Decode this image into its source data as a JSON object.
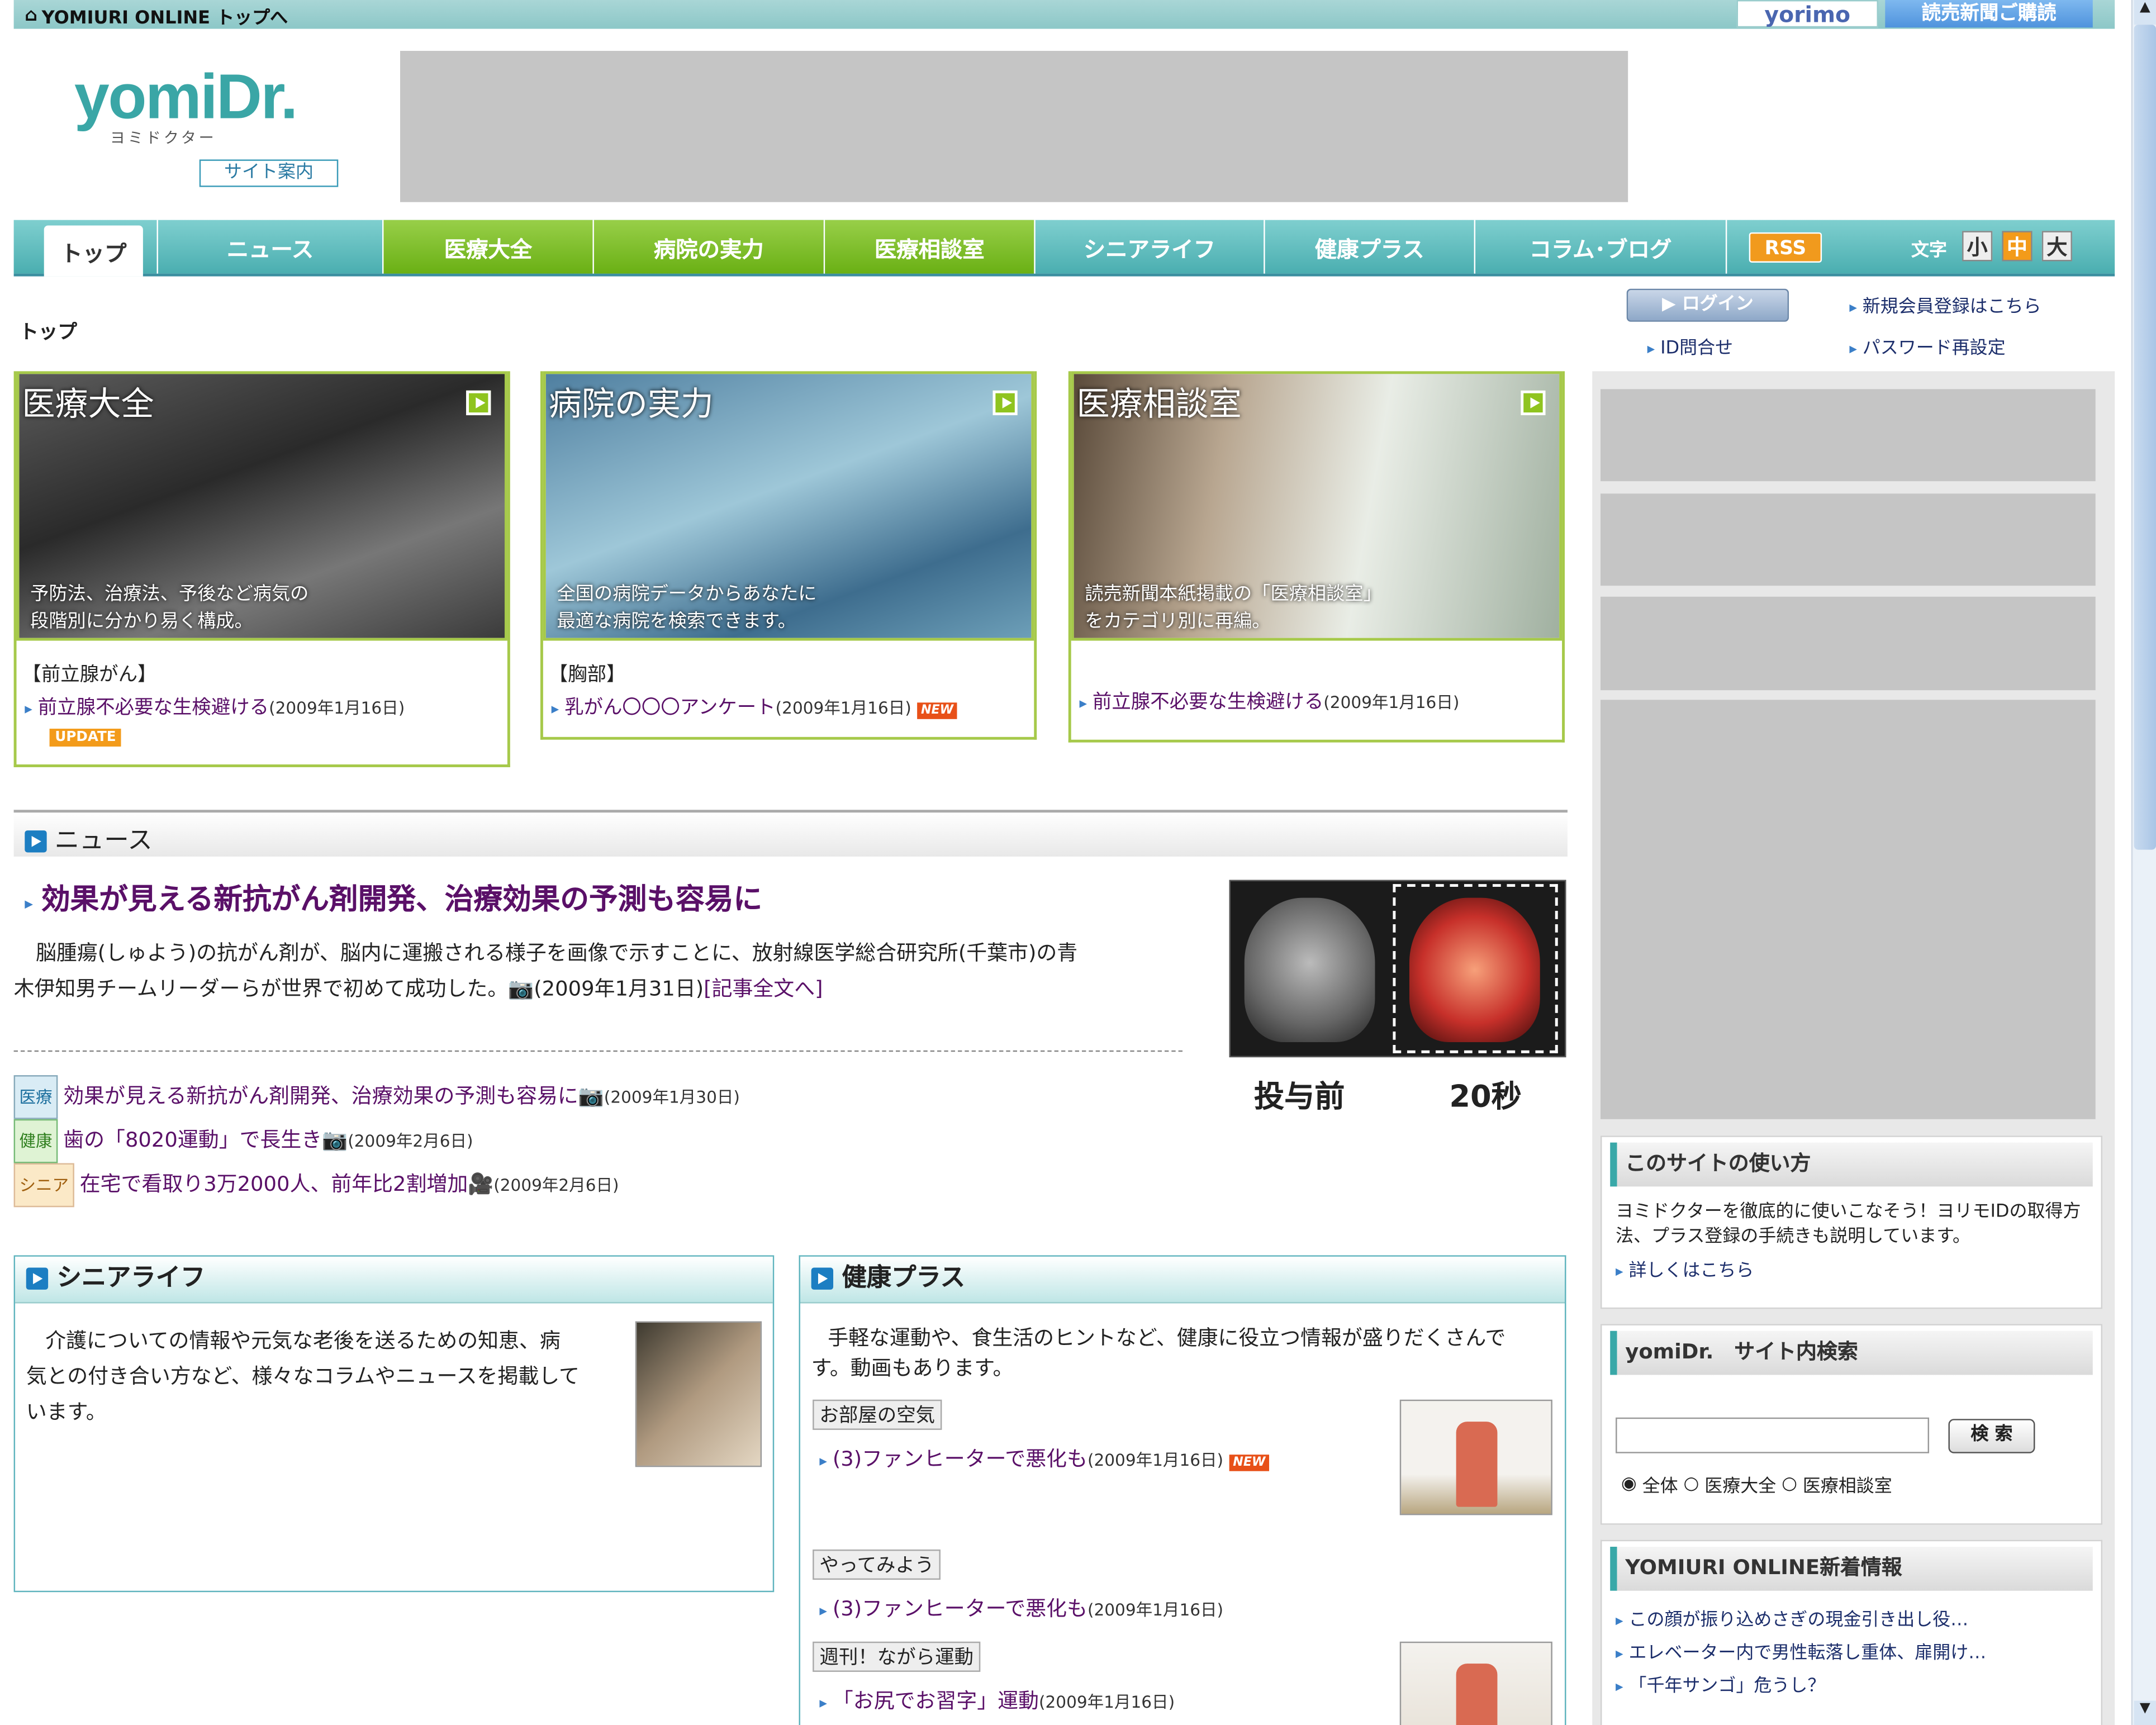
{
  "topbar": {
    "home_label": "YOMIURI ONLINE トップへ",
    "yorimo": "yorimo",
    "subscribe": "読売新聞ご購読"
  },
  "header": {
    "logo": "yomiDr.",
    "logo_sub": "ヨミドクター",
    "site_guide": "サイト案内"
  },
  "nav": {
    "items": [
      "トップ",
      "ニュース",
      "医療大全",
      "病院の実力",
      "医療相談室",
      "シニアライフ",
      "健康プラス",
      "コラム･ブログ"
    ],
    "rss": "RSS",
    "font_label": "文字",
    "sizes": [
      "小",
      "中",
      "大"
    ]
  },
  "breadcrumb": "トップ",
  "account": {
    "login": "▶ ログイン",
    "register": "新規会員登録はこちら",
    "id_inquiry": "ID問合せ",
    "password_reset": "パスワード再設定"
  },
  "features": [
    {
      "title": "医療大全",
      "desc1": "予防法、治療法、予後など病気の",
      "desc2": "段階別に分かり易く構成。",
      "category": "【前立腺がん】",
      "article": "前立腺不必要な生検避ける",
      "date": "(2009年1月16日)",
      "badge": "UPDATE"
    },
    {
      "title": "病院の実力",
      "desc1": "全国の病院データからあなたに",
      "desc2": "最適な病院を検索できます。",
      "category": "【胸部】",
      "article": "乳がん〇〇〇アンケート",
      "date": "(2009年1月16日)",
      "badge": "NEW"
    },
    {
      "title": "医療相談室",
      "desc1": "読売新聞本紙掲載の「医療相談室」",
      "desc2": "をカテゴリ別に再編。",
      "category": "",
      "article": "前立腺不必要な生検避ける",
      "date": "(2009年1月16日)",
      "badge": ""
    }
  ],
  "news": {
    "heading": "ニュース",
    "headline": "効果が見える新抗がん剤開発、治療効果の予測も容易に",
    "body1": "脳腫瘍(しゅよう)の抗がん剤が、脳内に運搬される様子を画像で示すことに、放射線医学総合研究所(千葉市)の青",
    "body2": "木伊知男チームリーダーらが世界で初めて成功した。",
    "date": "(2009年1月31日)",
    "more": "[記事全文へ]",
    "image_caption_left": "投与前",
    "image_caption_right": "20秒",
    "items": [
      {
        "tag": "医療",
        "title": "効果が見える新抗がん剤開発、治療効果の予測も容易に",
        "date": "(2009年1月30日)"
      },
      {
        "tag": "健康",
        "title": "歯の「8020運動」で長生き",
        "date": "(2009年2月6日)"
      },
      {
        "tag": "シニア",
        "title": "在宅で看取り3万2000人、前年比2割増加",
        "date": "(2009年2月6日)"
      }
    ]
  },
  "senior": {
    "heading": "シニアライフ",
    "desc1": "介護についての情報や元気な老後を送るための知恵、病",
    "desc2": "気との付き合い方など、様々なコラムやニュースを掲載して",
    "desc3": "います。"
  },
  "health": {
    "heading": "健康プラス",
    "desc1": "手軽な運動や、食生活のヒントなど、健康に役立つ情報が盛りだくさんで",
    "desc2": "す。動画もあります。",
    "sections": [
      {
        "label": "お部屋の空気",
        "article": "(3)ファンヒーターで悪化も",
        "date": "(2009年1月16日)",
        "badge": "NEW"
      },
      {
        "label": "やってみよう",
        "article": "(3)ファンヒーターで悪化も",
        "date": "(2009年1月16日)",
        "badge": ""
      },
      {
        "label": "週刊！ながら運動",
        "article": "「お尻でお習字」運動",
        "date": "(2009年1月16日)",
        "badge": ""
      }
    ]
  },
  "howto": {
    "heading": "このサイトの使い方",
    "desc1": "ヨミドクターを徹底的に使いこなそう！ヨリモIDの取得方",
    "desc2": "法、プラス登録の手続きも説明しています。",
    "link": "詳しくはこちら"
  },
  "search": {
    "heading": "yomiDr.　サイト内検索",
    "button": "検 索",
    "value": "",
    "options": [
      "全体",
      "医療大全",
      "医療相談室"
    ],
    "selected": "全体"
  },
  "yol": {
    "heading": "YOMIURI ONLINE新着情報",
    "items": [
      "この顔が振り込めさぎの現金引き出し役…",
      "エレベーター内で男性転落し重体、扉開け…",
      "「千年サンゴ」危うし？"
    ]
  },
  "colors": {
    "nav_teal": "#4aaeb0",
    "nav_green": "#6ab014",
    "link": "#5a1068",
    "accent_orange": "#f39b1a"
  }
}
